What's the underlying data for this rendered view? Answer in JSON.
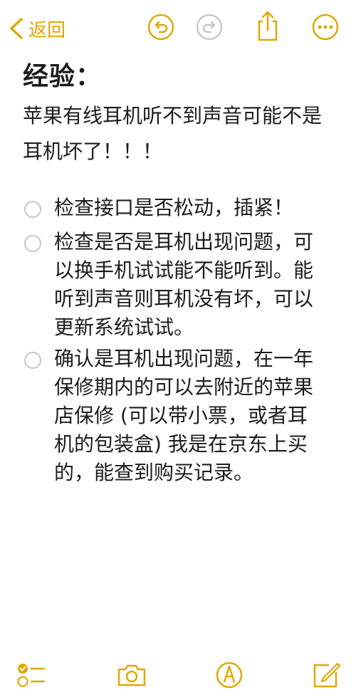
{
  "nav": {
    "back_label": "返回",
    "icons": [
      "chevron-left-icon",
      "undo-icon",
      "redo-icon",
      "share-icon",
      "more-icon"
    ],
    "accent": "#e0a800",
    "disabled": "#c7c7cc"
  },
  "note": {
    "title": "经验：",
    "paragraph": "苹果有线耳机听不到声音可能不是耳机坏了！！！",
    "checklist": [
      {
        "text": "检查接口是否松动，插紧！",
        "checked": false
      },
      {
        "text": "检查是否是耳机出现问题，可以换手机试试能不能听到。能听到声音则耳机没有坏，可以更新系统试试。",
        "checked": false
      },
      {
        "text": "确认是耳机出现问题，在一年保修期内的可以去附近的苹果店保修 (可以带小票，或者耳机的包装盒) 我是在京东上买的，能查到购买记录。",
        "checked": false
      }
    ]
  },
  "toolbar": {
    "icons": [
      "checklist-icon",
      "camera-icon",
      "markup-icon",
      "compose-icon"
    ]
  }
}
